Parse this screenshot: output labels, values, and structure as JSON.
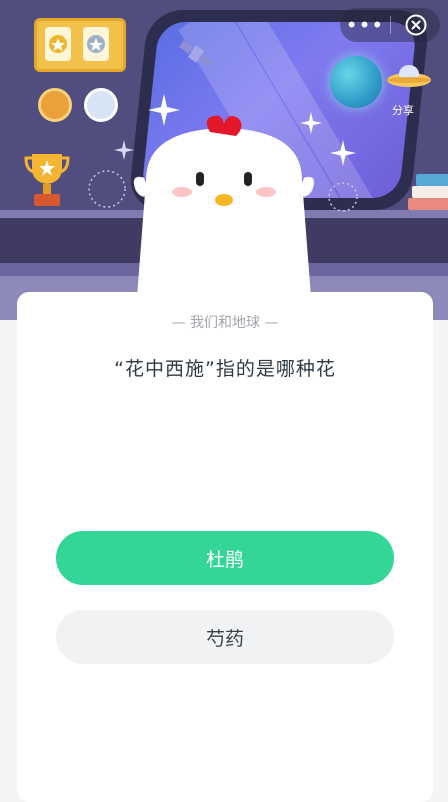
{
  "menu": {
    "more_icon": "more-dots-icon",
    "close_icon": "close-circle-icon"
  },
  "scene": {
    "share_label": "分享"
  },
  "quiz": {
    "category": "— 我们和地球 —",
    "question": "“花中西施”指的是哪种花",
    "options": [
      "杜鹃",
      "芍药"
    ]
  },
  "colors": {
    "primary": "#33d696",
    "scene_bg": "#4d4a79",
    "card_bg": "#ffffff"
  }
}
